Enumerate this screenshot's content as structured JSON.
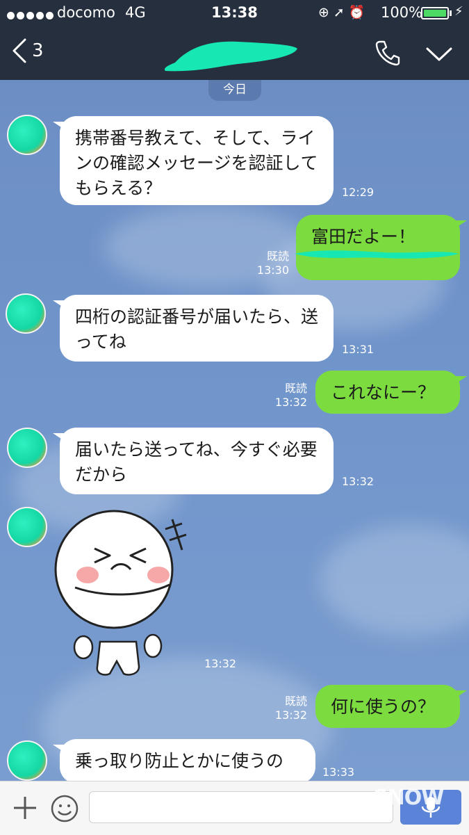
{
  "status_bar": {
    "carrier": "docomo",
    "network": "4G",
    "time": "13:38",
    "battery_percent": "100%",
    "battery_level": 1.0
  },
  "header": {
    "back_count": "3"
  },
  "chat": {
    "date_label": "今日",
    "read_label": "既読",
    "messages": [
      {
        "side": "in",
        "text": "携帯番号教えて、そして、ライ​ンの確認メッセージを認証し​てもらえる？",
        "time": "12:29"
      },
      {
        "side": "out",
        "text": "富田だよー！",
        "time": "13:30"
      },
      {
        "side": "in",
        "text": "四桁の認証番号が届いたら、送ってね",
        "time": "13:31"
      },
      {
        "side": "out",
        "text": "これなにー？",
        "time": "13:32"
      },
      {
        "side": "in",
        "text": "届いたら送ってね、今すぐ必要だから",
        "time": "13:32"
      },
      {
        "side": "in",
        "text": "",
        "time": "13:32"
      },
      {
        "side": "out",
        "text": "何に使うの？",
        "time": "13:32"
      },
      {
        "side": "in",
        "text": "乗っ取り防止とかに使うの",
        "time": "13:33"
      }
    ]
  },
  "watermark": "SNOW",
  "colors": {
    "header_bg": "#262f3e",
    "outgoing_bubble": "#7cdc3f",
    "incoming_bubble": "#ffffff",
    "chat_bg": "#6f92c6"
  }
}
